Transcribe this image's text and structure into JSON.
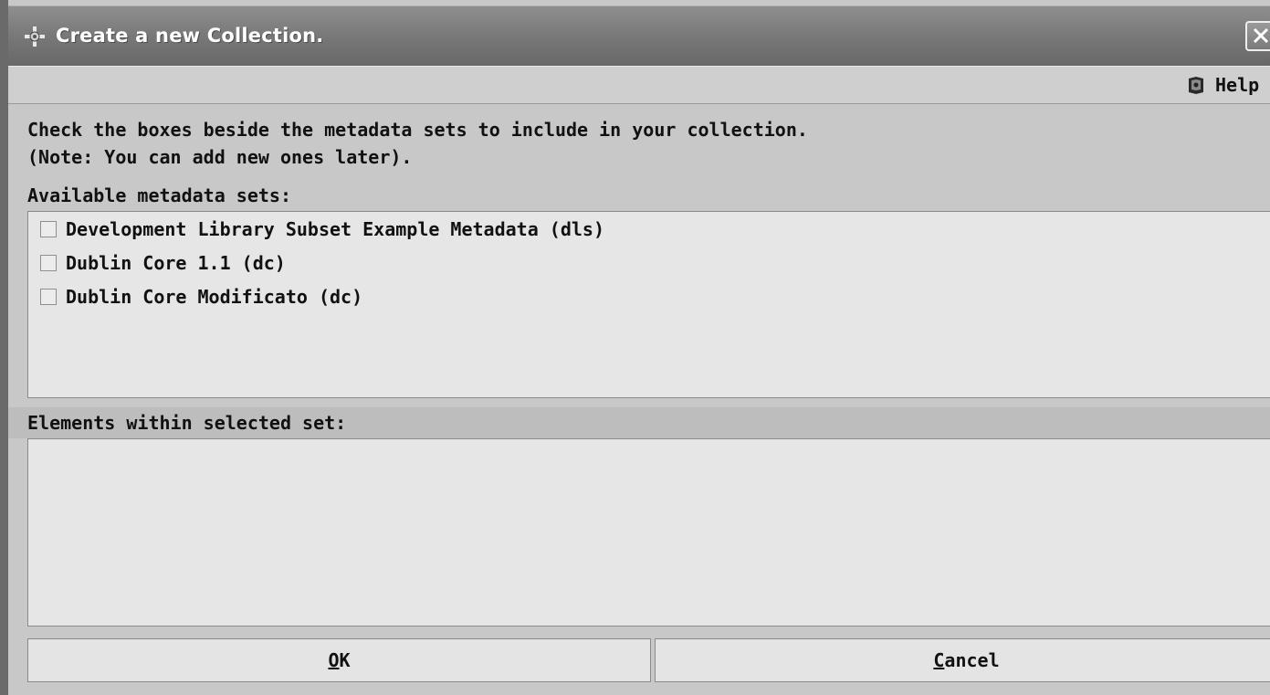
{
  "window": {
    "title": "Create a new Collection.",
    "close_symbol": "✕"
  },
  "help": {
    "label": "Help"
  },
  "instructions": {
    "line1": "Check the boxes beside the metadata sets to include in your collection.",
    "line2": "(Note: You can add new ones later)."
  },
  "available": {
    "label": "Available metadata sets:",
    "items": [
      {
        "label": "Development Library Subset Example Metadata (dls)",
        "checked": false
      },
      {
        "label": "Dublin Core 1.1 (dc)",
        "checked": false
      },
      {
        "label": "Dublin Core Modificato (dc)",
        "checked": false
      }
    ]
  },
  "elements": {
    "label": "Elements within selected set:"
  },
  "buttons": {
    "ok": {
      "mnemonic": "O",
      "rest": "K"
    },
    "cancel": {
      "mnemonic": "C",
      "rest": "ancel"
    }
  }
}
